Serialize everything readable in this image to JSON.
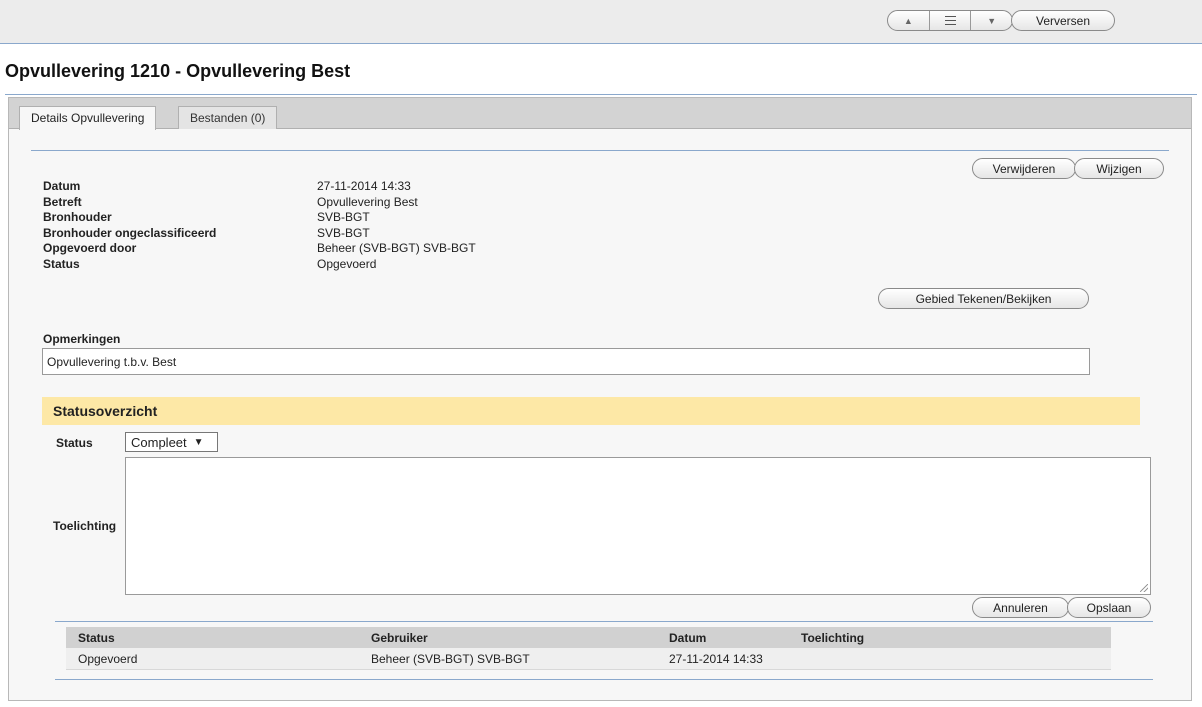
{
  "toolbar": {
    "refresh_label": "Verversen",
    "prev_icon": "▲",
    "next_icon": "▼"
  },
  "page": {
    "title": "Opvullevering 1210 - Opvullevering Best"
  },
  "tabs": [
    {
      "label": "Details Opvullevering",
      "active": true
    },
    {
      "label": "Bestanden (0)",
      "active": false
    }
  ],
  "actions": {
    "delete_label": "Verwijderen",
    "edit_label": "Wijzigen",
    "area_label": "Gebied Tekenen/Bekijken"
  },
  "details": [
    {
      "label": "Datum",
      "value": "27-11-2014 14:33"
    },
    {
      "label": "Betreft",
      "value": "Opvullevering Best"
    },
    {
      "label": "Bronhouder",
      "value": "SVB-BGT"
    },
    {
      "label": "Bronhouder ongeclassificeerd",
      "value": "SVB-BGT"
    },
    {
      "label": "Opgevoerd door",
      "value": "Beheer (SVB-BGT) SVB-BGT"
    },
    {
      "label": "Status",
      "value": "Opgevoerd"
    }
  ],
  "remarks": {
    "label": "Opmerkingen",
    "value": "Opvullevering t.b.v. Best"
  },
  "status_overview": {
    "title": "Statusoverzicht",
    "status_label": "Status",
    "status_selected": "Compleet",
    "status_arrow": "▼",
    "explanation_label": "Toelichting",
    "explanation_value": "",
    "cancel_label": "Annuleren",
    "save_label": "Opslaan"
  },
  "history": {
    "columns": [
      "Status",
      "Gebruiker",
      "Datum",
      "Toelichting"
    ],
    "rows": [
      [
        "Opgevoerd",
        "Beheer (SVB-BGT) SVB-BGT",
        "27-11-2014 14:33",
        ""
      ]
    ]
  },
  "colors": {
    "accent_rule": "#8aa8cc",
    "status_header_bg": "#fde8a6"
  }
}
